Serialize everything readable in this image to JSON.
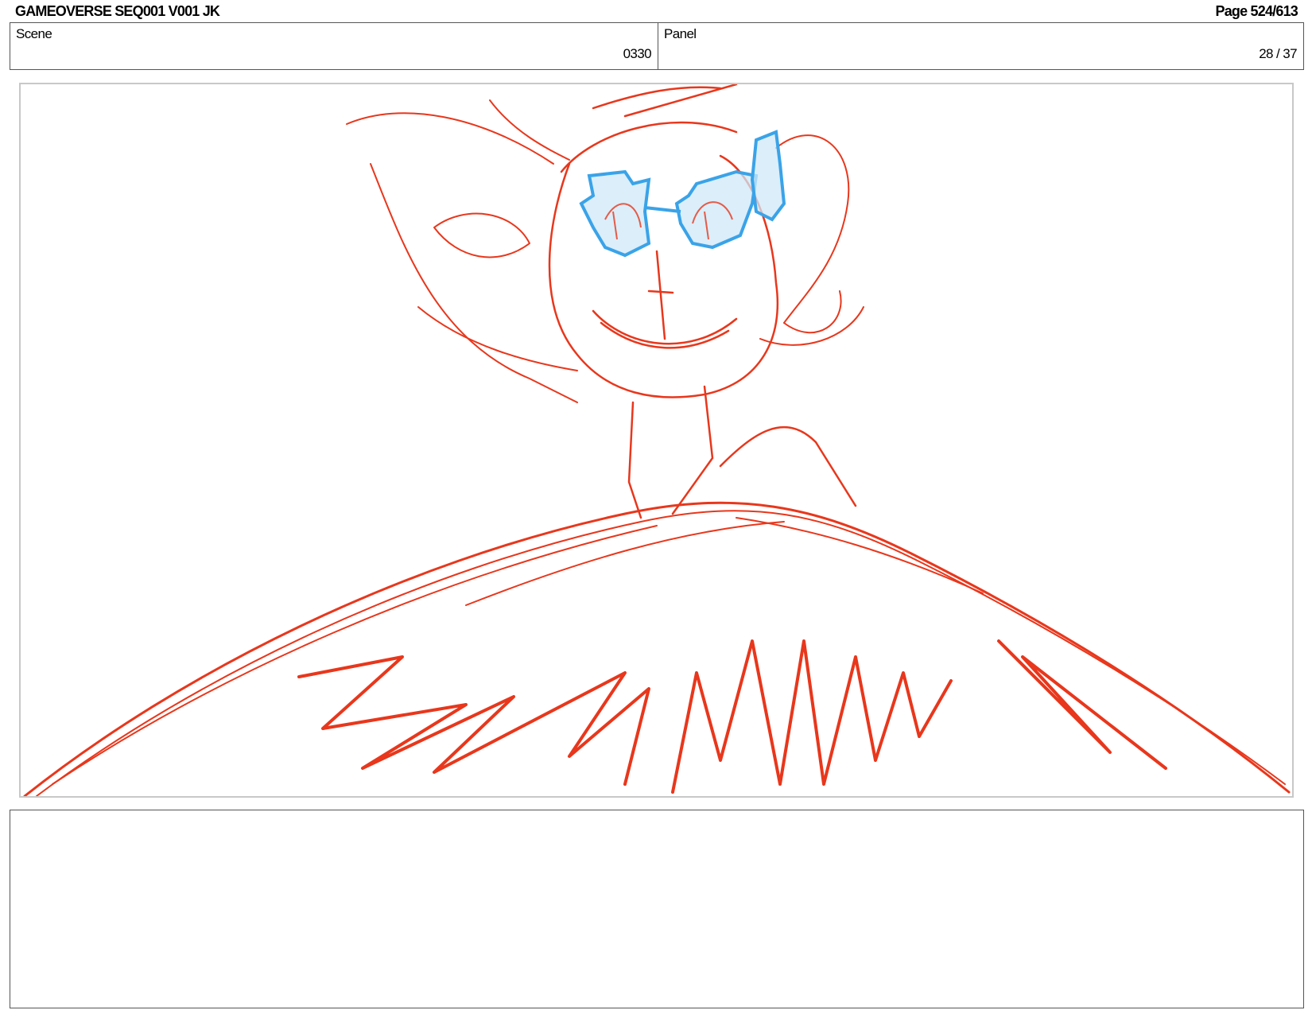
{
  "header": {
    "title": "GAMEOVERSE SEQ001 V001 JK",
    "page": "Page 524/613"
  },
  "scene": {
    "label": "Scene",
    "value": "0330"
  },
  "panel": {
    "label": "Panel",
    "value": "28 / 37"
  },
  "notes": {
    "text": ""
  },
  "colors": {
    "sketch_red": "#e8371c",
    "glasses_blue": "#3aa3e8",
    "glasses_fill": "#cfe8f8"
  }
}
